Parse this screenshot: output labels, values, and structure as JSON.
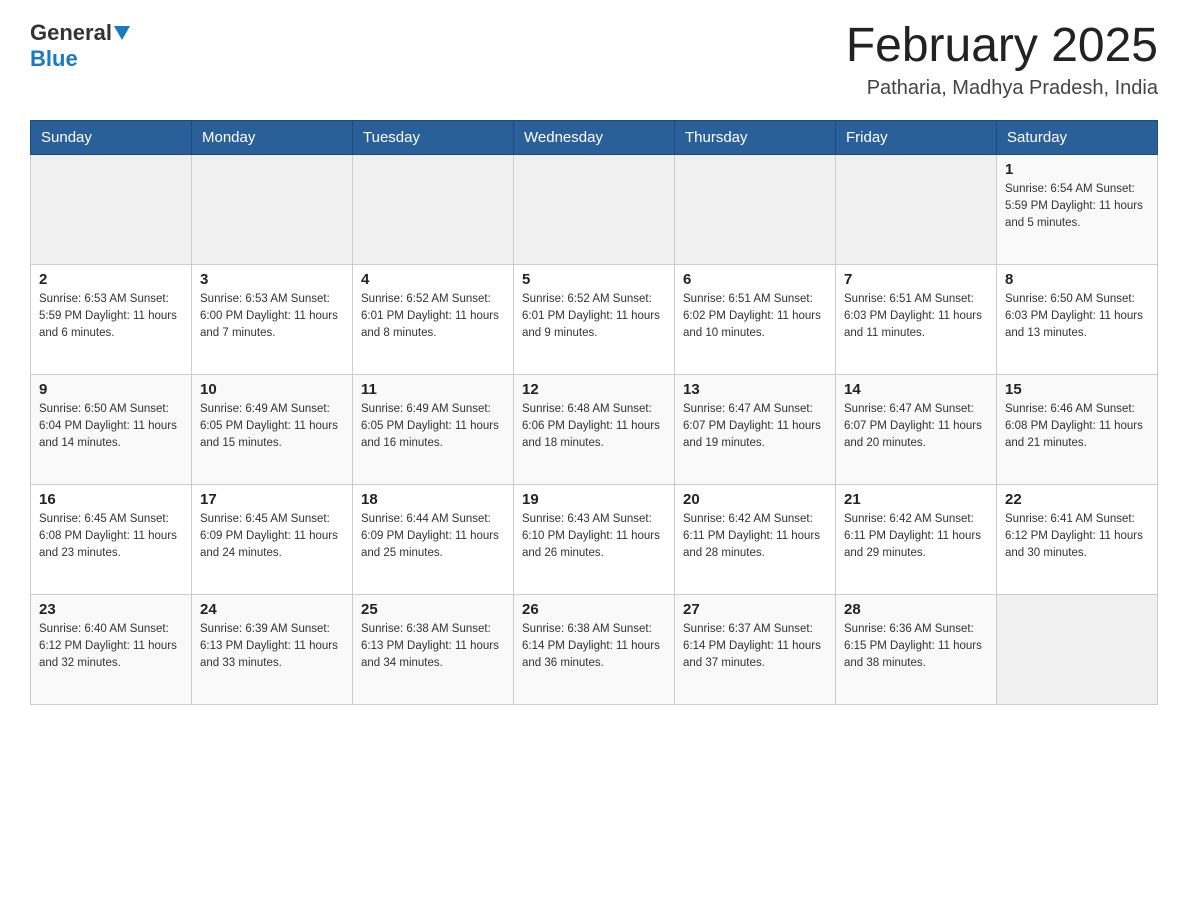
{
  "header": {
    "logo_general": "General",
    "logo_blue": "Blue",
    "month_title": "February 2025",
    "location": "Patharia, Madhya Pradesh, India"
  },
  "weekdays": [
    "Sunday",
    "Monday",
    "Tuesday",
    "Wednesday",
    "Thursday",
    "Friday",
    "Saturday"
  ],
  "weeks": [
    [
      {
        "day": "",
        "info": ""
      },
      {
        "day": "",
        "info": ""
      },
      {
        "day": "",
        "info": ""
      },
      {
        "day": "",
        "info": ""
      },
      {
        "day": "",
        "info": ""
      },
      {
        "day": "",
        "info": ""
      },
      {
        "day": "1",
        "info": "Sunrise: 6:54 AM\nSunset: 5:59 PM\nDaylight: 11 hours and 5 minutes."
      }
    ],
    [
      {
        "day": "2",
        "info": "Sunrise: 6:53 AM\nSunset: 5:59 PM\nDaylight: 11 hours and 6 minutes."
      },
      {
        "day": "3",
        "info": "Sunrise: 6:53 AM\nSunset: 6:00 PM\nDaylight: 11 hours and 7 minutes."
      },
      {
        "day": "4",
        "info": "Sunrise: 6:52 AM\nSunset: 6:01 PM\nDaylight: 11 hours and 8 minutes."
      },
      {
        "day": "5",
        "info": "Sunrise: 6:52 AM\nSunset: 6:01 PM\nDaylight: 11 hours and 9 minutes."
      },
      {
        "day": "6",
        "info": "Sunrise: 6:51 AM\nSunset: 6:02 PM\nDaylight: 11 hours and 10 minutes."
      },
      {
        "day": "7",
        "info": "Sunrise: 6:51 AM\nSunset: 6:03 PM\nDaylight: 11 hours and 11 minutes."
      },
      {
        "day": "8",
        "info": "Sunrise: 6:50 AM\nSunset: 6:03 PM\nDaylight: 11 hours and 13 minutes."
      }
    ],
    [
      {
        "day": "9",
        "info": "Sunrise: 6:50 AM\nSunset: 6:04 PM\nDaylight: 11 hours and 14 minutes."
      },
      {
        "day": "10",
        "info": "Sunrise: 6:49 AM\nSunset: 6:05 PM\nDaylight: 11 hours and 15 minutes."
      },
      {
        "day": "11",
        "info": "Sunrise: 6:49 AM\nSunset: 6:05 PM\nDaylight: 11 hours and 16 minutes."
      },
      {
        "day": "12",
        "info": "Sunrise: 6:48 AM\nSunset: 6:06 PM\nDaylight: 11 hours and 18 minutes."
      },
      {
        "day": "13",
        "info": "Sunrise: 6:47 AM\nSunset: 6:07 PM\nDaylight: 11 hours and 19 minutes."
      },
      {
        "day": "14",
        "info": "Sunrise: 6:47 AM\nSunset: 6:07 PM\nDaylight: 11 hours and 20 minutes."
      },
      {
        "day": "15",
        "info": "Sunrise: 6:46 AM\nSunset: 6:08 PM\nDaylight: 11 hours and 21 minutes."
      }
    ],
    [
      {
        "day": "16",
        "info": "Sunrise: 6:45 AM\nSunset: 6:08 PM\nDaylight: 11 hours and 23 minutes."
      },
      {
        "day": "17",
        "info": "Sunrise: 6:45 AM\nSunset: 6:09 PM\nDaylight: 11 hours and 24 minutes."
      },
      {
        "day": "18",
        "info": "Sunrise: 6:44 AM\nSunset: 6:09 PM\nDaylight: 11 hours and 25 minutes."
      },
      {
        "day": "19",
        "info": "Sunrise: 6:43 AM\nSunset: 6:10 PM\nDaylight: 11 hours and 26 minutes."
      },
      {
        "day": "20",
        "info": "Sunrise: 6:42 AM\nSunset: 6:11 PM\nDaylight: 11 hours and 28 minutes."
      },
      {
        "day": "21",
        "info": "Sunrise: 6:42 AM\nSunset: 6:11 PM\nDaylight: 11 hours and 29 minutes."
      },
      {
        "day": "22",
        "info": "Sunrise: 6:41 AM\nSunset: 6:12 PM\nDaylight: 11 hours and 30 minutes."
      }
    ],
    [
      {
        "day": "23",
        "info": "Sunrise: 6:40 AM\nSunset: 6:12 PM\nDaylight: 11 hours and 32 minutes."
      },
      {
        "day": "24",
        "info": "Sunrise: 6:39 AM\nSunset: 6:13 PM\nDaylight: 11 hours and 33 minutes."
      },
      {
        "day": "25",
        "info": "Sunrise: 6:38 AM\nSunset: 6:13 PM\nDaylight: 11 hours and 34 minutes."
      },
      {
        "day": "26",
        "info": "Sunrise: 6:38 AM\nSunset: 6:14 PM\nDaylight: 11 hours and 36 minutes."
      },
      {
        "day": "27",
        "info": "Sunrise: 6:37 AM\nSunset: 6:14 PM\nDaylight: 11 hours and 37 minutes."
      },
      {
        "day": "28",
        "info": "Sunrise: 6:36 AM\nSunset: 6:15 PM\nDaylight: 11 hours and 38 minutes."
      },
      {
        "day": "",
        "info": ""
      }
    ]
  ]
}
